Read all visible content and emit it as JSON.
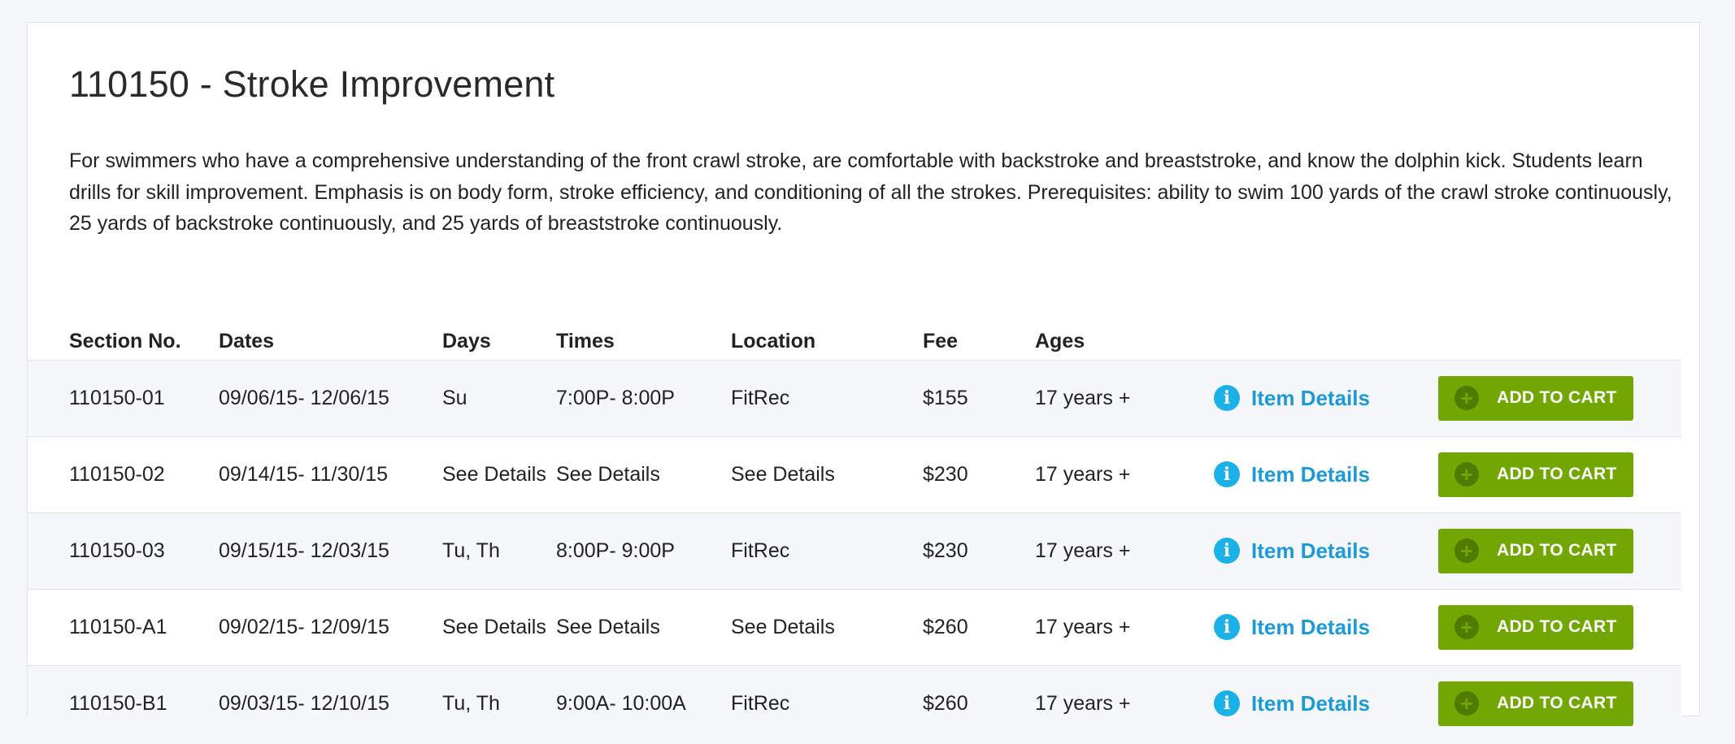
{
  "course": {
    "title": "110150 - Stroke Improvement",
    "description": "For swimmers who have a comprehensive understanding of the front crawl stroke, are comfortable with backstroke and breaststroke, and know the dolphin kick. Students learn drills for skill improvement. Emphasis is on body form, stroke efficiency, and conditioning of all the strokes. Prerequisites: ability to swim 100 yards of the crawl stroke continuously, 25 yards of backstroke continuously, and 25 yards of breaststroke continuously."
  },
  "table": {
    "headers": {
      "section": "Section No.",
      "dates": "Dates",
      "days": "Days",
      "times": "Times",
      "location": "Location",
      "fee": "Fee",
      "ages": "Ages"
    },
    "rows": [
      {
        "section": "110150-01",
        "dates": "09/06/15- 12/06/15",
        "days": "Su",
        "times": "7:00P- 8:00P",
        "location": "FitRec",
        "fee": "$155",
        "ages": "17 years +",
        "details_label": "Item Details",
        "cart_label": "ADD TO CART"
      },
      {
        "section": "110150-02",
        "dates": "09/14/15- 11/30/15",
        "days": "See Details",
        "times": "See Details",
        "location": "See Details",
        "fee": "$230",
        "ages": "17 years +",
        "details_label": "Item Details",
        "cart_label": "ADD TO CART"
      },
      {
        "section": "110150-03",
        "dates": "09/15/15- 12/03/15",
        "days": "Tu, Th",
        "times": "8:00P- 9:00P",
        "location": "FitRec",
        "fee": "$230",
        "ages": "17 years +",
        "details_label": "Item Details",
        "cart_label": "ADD TO CART"
      },
      {
        "section": "110150-A1",
        "dates": "09/02/15- 12/09/15",
        "days": "See Details",
        "times": "See Details",
        "location": "See Details",
        "fee": "$260",
        "ages": "17 years +",
        "details_label": "Item Details",
        "cart_label": "ADD TO CART"
      },
      {
        "section": "110150-B1",
        "dates": "09/03/15- 12/10/15",
        "days": "Tu, Th",
        "times": "9:00A- 10:00A",
        "location": "FitRec",
        "fee": "$260",
        "ages": "17 years +",
        "details_label": "Item Details",
        "cart_label": "ADD TO CART"
      }
    ]
  },
  "icons": {
    "info": "info-icon",
    "add": "plus-circle-icon"
  },
  "colors": {
    "link": "#1a9ad6",
    "info_icon": "#1ab0e8",
    "cart_button": "#72a702",
    "cart_icon": "#507a00",
    "row_shade": "#f6f7fb",
    "border": "#dde2ee"
  }
}
